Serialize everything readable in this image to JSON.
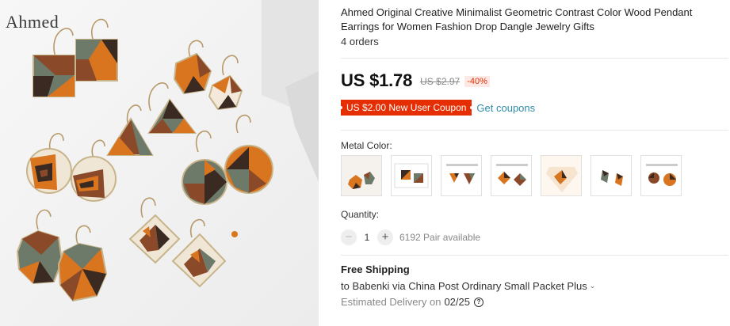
{
  "product": {
    "brand_watermark": "Ahmed",
    "title": "Ahmed Original Creative Minimalist Geometric Contrast Color Wood Pendant Earrings for Women Fashion Drop Dangle Jewelry Gifts",
    "orders": "4 orders"
  },
  "pricing": {
    "price": "US $1.78",
    "original_price": "US $2.97",
    "discount": "-40%",
    "coupon": "US $2.00 New User Coupon",
    "get_coupons": "Get coupons"
  },
  "variants": {
    "label": "Metal Color:",
    "options": [
      {
        "icon": "earring-hexagon-thumb"
      },
      {
        "icon": "earring-square-thumb"
      },
      {
        "icon": "earring-triangle-thumb"
      },
      {
        "icon": "earring-diamond-thumb"
      },
      {
        "icon": "earring-rhombus-thumb"
      },
      {
        "icon": "earring-kite-thumb"
      },
      {
        "icon": "earring-circle-thumb"
      }
    ]
  },
  "quantity": {
    "label": "Quantity:",
    "minus": "−",
    "value": "1",
    "plus": "+",
    "available": "6192 Pair available"
  },
  "shipping": {
    "title": "Free Shipping",
    "to": "to Babenki via China Post Ordinary Small Packet Plus",
    "delivery_label": "Estimated Delivery on",
    "delivery_date": "02/25",
    "help": "?"
  },
  "colors": {
    "price_red": "#e62e04",
    "link_teal": "#2e8ca8",
    "wood_orange": "#d9741f",
    "wood_dark": "#3a2a22",
    "wood_brown": "#8a4a2a",
    "slate_green": "#6d7a6a"
  }
}
